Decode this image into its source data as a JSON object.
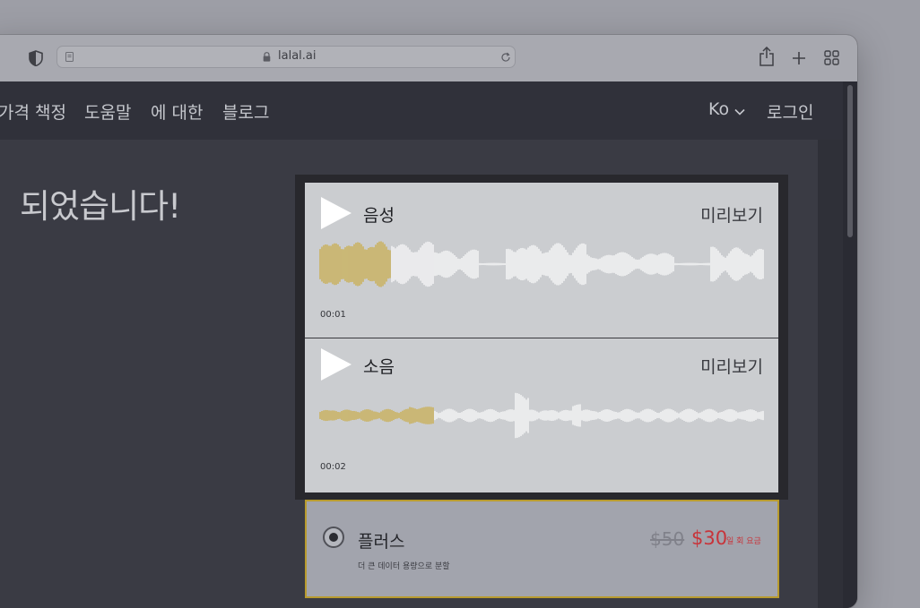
{
  "browser": {
    "url": "lalal.ai"
  },
  "nav": {
    "items": [
      "가격 책정",
      "도움말",
      "에 대한",
      "블로그"
    ],
    "language": "Ko",
    "login": "로그인"
  },
  "main": {
    "heading": "되었습니다!"
  },
  "player": {
    "tracks": [
      {
        "label": "음성",
        "preview": "미리보기",
        "time": "00:01",
        "progress": 0.16
      },
      {
        "label": "소음",
        "preview": "미리보기",
        "time": "00:02",
        "progress": 0.26
      }
    ]
  },
  "plan": {
    "name": "플러스",
    "description": "더 큰 데이터 용량으로 분할",
    "old_price": "$50",
    "new_price": "$30",
    "price_note": "일 회 요금",
    "selected": true
  },
  "colors": {
    "played": "#c9a93a",
    "unplayed": "#ffffff",
    "accent_red": "#c8343a",
    "plan_border": "#b89b2e"
  }
}
